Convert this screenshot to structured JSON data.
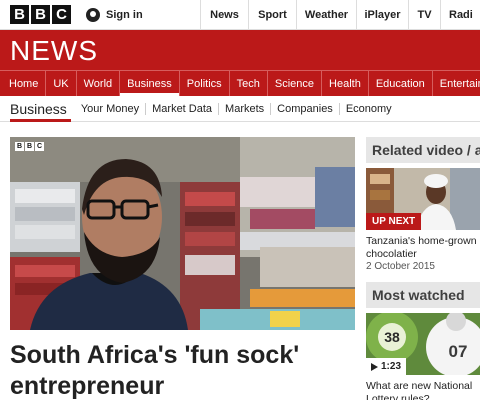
{
  "brand": {
    "letters": [
      "B",
      "B",
      "C"
    ]
  },
  "signin": {
    "label": "Sign in",
    "icon": "user-icon"
  },
  "topnav": [
    "News",
    "Sport",
    "Weather",
    "iPlayer",
    "TV",
    "Radi"
  ],
  "masthead": {
    "title": "NEWS"
  },
  "rednav": {
    "items": [
      "Home",
      "UK",
      "World",
      "Business",
      "Politics",
      "Tech",
      "Science",
      "Health",
      "Education",
      "Entertain"
    ],
    "active": "Business"
  },
  "subnav": {
    "section": "Business",
    "links": [
      "Your Money",
      "Market Data",
      "Markets",
      "Companies",
      "Economy"
    ]
  },
  "video": {
    "bug_letters": [
      "B",
      "B",
      "C"
    ]
  },
  "article": {
    "headline": "South Africa's 'fun sock' entrepreneur"
  },
  "related": {
    "heading": "Related video / a",
    "badge": "UP NEXT",
    "title": "Tanzania's home-grown chocolatier",
    "date": "2 October 2015"
  },
  "most_watched": {
    "heading": "Most watched",
    "duration": "1:23",
    "ball_numbers": [
      "38",
      "07"
    ],
    "title": "What are new National Lottery rules?"
  },
  "colors": {
    "accent": "#bb1919",
    "panel": "#e6e6e6"
  }
}
